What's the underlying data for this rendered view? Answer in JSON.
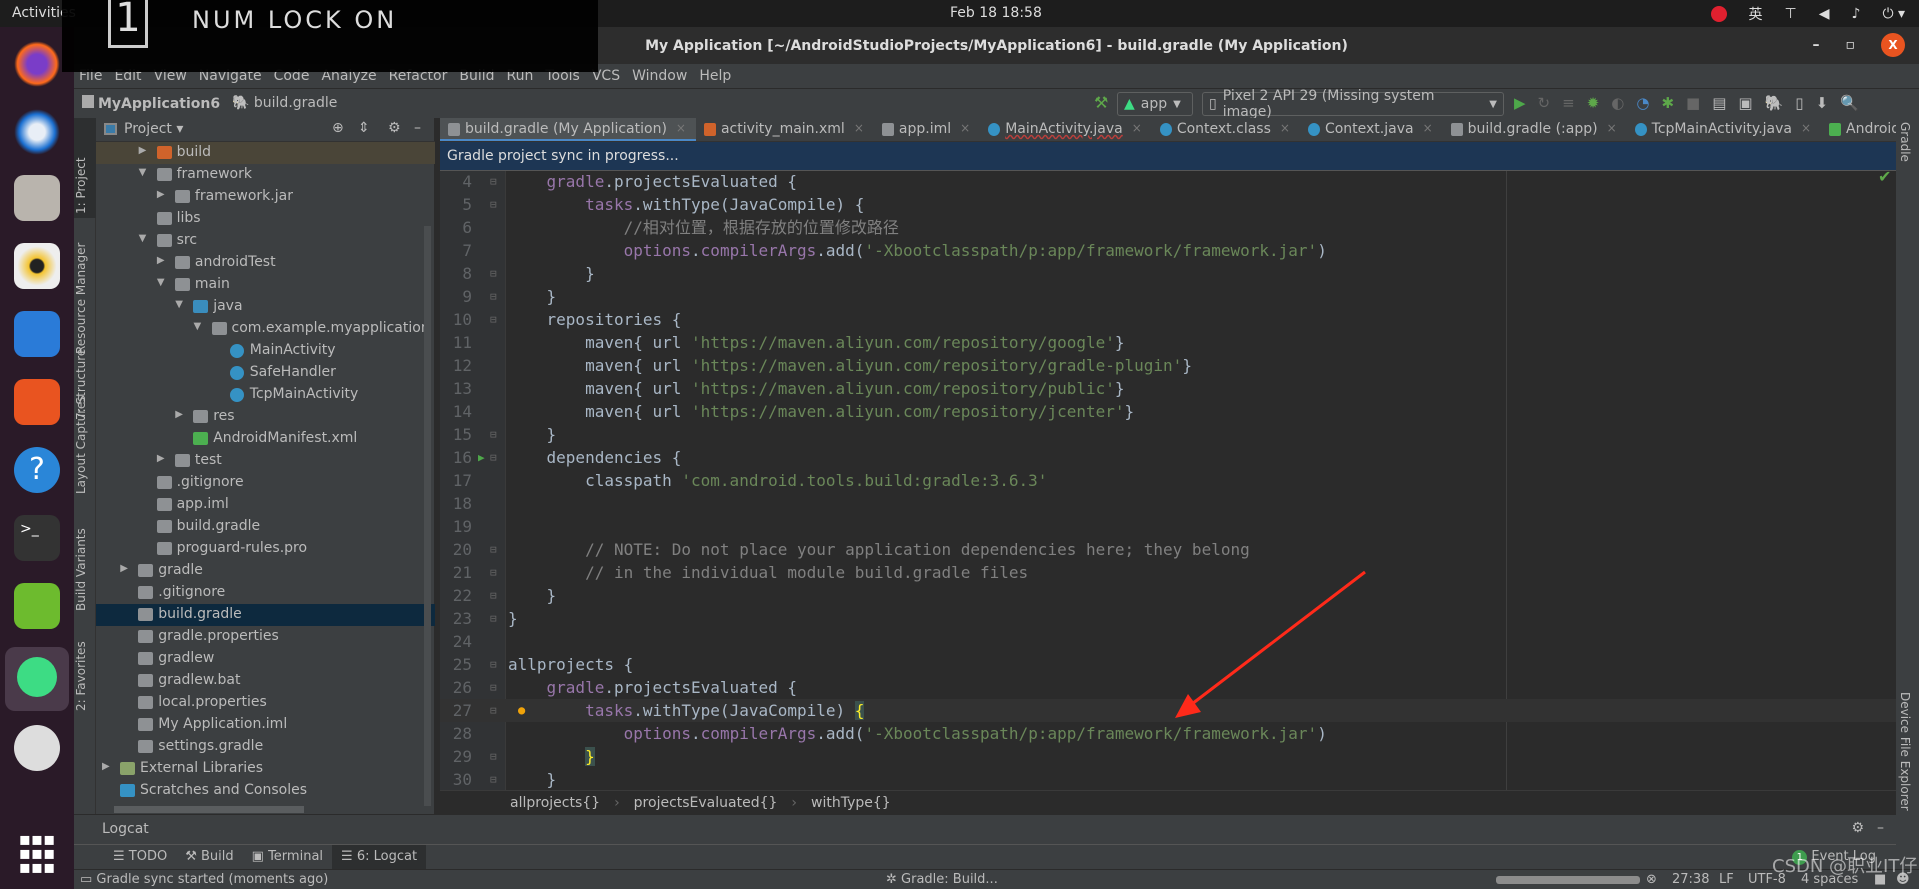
{
  "os": {
    "activities": "Activities",
    "clock": "Feb 18  18:58",
    "input_method": "英",
    "numlock_digit": "1",
    "numlock_text": "NUM LOCK ON"
  },
  "window": {
    "title": "My Application [~/AndroidStudioProjects/MyApplication6] - build.gradle (My Application)"
  },
  "menu": [
    "File",
    "Edit",
    "View",
    "Navigate",
    "Code",
    "Analyze",
    "Refactor",
    "Build",
    "Run",
    "Tools",
    "VCS",
    "Window",
    "Help"
  ],
  "nav": {
    "project": "MyApplication6",
    "file": "build.gradle",
    "run_config": "app",
    "device": "Pixel 2 API 29 (Missing system image)"
  },
  "left_strip": [
    "1: Project",
    "Resource Manager",
    "7: Structure",
    "Layout Captures",
    "Build Variants",
    "2: Favorites"
  ],
  "right_strip": [
    "Gradle",
    "Device File Explorer"
  ],
  "project_panel": {
    "title": "Project",
    "rows": [
      {
        "label": "build",
        "depth": 2,
        "arrow": "closed",
        "icon": "folder-excluded"
      },
      {
        "label": "framework",
        "depth": 2,
        "arrow": "open",
        "icon": "folder"
      },
      {
        "label": "framework.jar",
        "depth": 3,
        "arrow": "closed",
        "icon": "jar"
      },
      {
        "label": "libs",
        "depth": 2,
        "arrow": "none",
        "icon": "folder"
      },
      {
        "label": "src",
        "depth": 2,
        "arrow": "open",
        "icon": "folder"
      },
      {
        "label": "androidTest",
        "depth": 3,
        "arrow": "closed",
        "icon": "folder"
      },
      {
        "label": "main",
        "depth": 3,
        "arrow": "open",
        "icon": "folder"
      },
      {
        "label": "java",
        "depth": 4,
        "arrow": "open",
        "icon": "folder-source"
      },
      {
        "label": "com.example.myapplication",
        "depth": 5,
        "arrow": "open",
        "icon": "package"
      },
      {
        "label": "MainActivity",
        "depth": 6,
        "arrow": "none",
        "icon": "class"
      },
      {
        "label": "SafeHandler",
        "depth": 6,
        "arrow": "none",
        "icon": "class"
      },
      {
        "label": "TcpMainActivity",
        "depth": 6,
        "arrow": "none",
        "icon": "class"
      },
      {
        "label": "res",
        "depth": 4,
        "arrow": "closed",
        "icon": "folder-res"
      },
      {
        "label": "AndroidManifest.xml",
        "depth": 4,
        "arrow": "none",
        "icon": "manifest"
      },
      {
        "label": "test",
        "depth": 3,
        "arrow": "closed",
        "icon": "folder"
      },
      {
        "label": ".gitignore",
        "depth": 2,
        "arrow": "none",
        "icon": "ignore-file"
      },
      {
        "label": "app.iml",
        "depth": 2,
        "arrow": "none",
        "icon": "module-file"
      },
      {
        "label": "build.gradle",
        "depth": 2,
        "arrow": "none",
        "icon": "gradle"
      },
      {
        "label": "proguard-rules.pro",
        "depth": 2,
        "arrow": "none",
        "icon": "text-file"
      },
      {
        "label": "gradle",
        "depth": 1,
        "arrow": "closed",
        "icon": "folder"
      },
      {
        "label": ".gitignore",
        "depth": 1,
        "arrow": "none",
        "icon": "ignore-file"
      },
      {
        "label": "build.gradle",
        "depth": 1,
        "arrow": "none",
        "icon": "gradle",
        "selected": true
      },
      {
        "label": "gradle.properties",
        "depth": 1,
        "arrow": "none",
        "icon": "properties"
      },
      {
        "label": "gradlew",
        "depth": 1,
        "arrow": "none",
        "icon": "shell"
      },
      {
        "label": "gradlew.bat",
        "depth": 1,
        "arrow": "none",
        "icon": "text-file"
      },
      {
        "label": "local.properties",
        "depth": 1,
        "arrow": "none",
        "icon": "properties"
      },
      {
        "label": "My Application.iml",
        "depth": 1,
        "arrow": "none",
        "icon": "module-file"
      },
      {
        "label": "settings.gradle",
        "depth": 1,
        "arrow": "none",
        "icon": "gradle"
      },
      {
        "label": "External Libraries",
        "depth": 0,
        "arrow": "closed",
        "icon": "libraries"
      },
      {
        "label": "Scratches and Consoles",
        "depth": 0,
        "arrow": "none",
        "icon": "scratches"
      }
    ]
  },
  "tabs": [
    {
      "label": "build.gradle (My Application)",
      "icon": "gradle",
      "active": true
    },
    {
      "label": "activity_main.xml",
      "icon": "xml"
    },
    {
      "label": "app.iml",
      "icon": "module-file"
    },
    {
      "label": "MainActivity.java",
      "icon": "class"
    },
    {
      "label": "Context.class",
      "icon": "class"
    },
    {
      "label": "Context.java",
      "icon": "class"
    },
    {
      "label": "build.gradle (:app)",
      "icon": "gradle"
    },
    {
      "label": "TcpMainActivity.java",
      "icon": "class"
    },
    {
      "label": "AndroidI",
      "icon": "manifest"
    }
  ],
  "banner": "Gradle project sync in progress...",
  "code": {
    "current_line": 27,
    "lines": [
      {
        "n": 4,
        "t": [
          [
            "    ",
            "p"
          ],
          [
            "gradle",
            "k"
          ],
          [
            ".projectsEvaluated {",
            "p"
          ]
        ]
      },
      {
        "n": 5,
        "t": [
          [
            "        ",
            "p"
          ],
          [
            "tasks",
            "k"
          ],
          [
            ".withType(JavaCompile) {",
            "p"
          ]
        ]
      },
      {
        "n": 6,
        "t": [
          [
            "            ",
            "p"
          ],
          [
            "//相对位置，根据存放的位置修改路径",
            "c"
          ]
        ]
      },
      {
        "n": 7,
        "t": [
          [
            "            ",
            "p"
          ],
          [
            "options",
            "k"
          ],
          [
            ".",
            "p"
          ],
          [
            "compilerArgs",
            "k"
          ],
          [
            ".add(",
            "p"
          ],
          [
            "'-Xbootclasspath/p:app/framework/framework.jar'",
            "s"
          ],
          [
            ")",
            "p"
          ]
        ]
      },
      {
        "n": 8,
        "t": [
          [
            "        }",
            "p"
          ]
        ]
      },
      {
        "n": 9,
        "t": [
          [
            "    }",
            "p"
          ]
        ]
      },
      {
        "n": 10,
        "t": [
          [
            "    repositories {",
            "p"
          ]
        ]
      },
      {
        "n": 11,
        "t": [
          [
            "        maven{ url ",
            "p"
          ],
          [
            "'https://maven.aliyun.com/repository/google'",
            "s"
          ],
          [
            "}",
            "p"
          ]
        ]
      },
      {
        "n": 12,
        "t": [
          [
            "        maven{ url ",
            "p"
          ],
          [
            "'https://maven.aliyun.com/repository/gradle-plugin'",
            "s"
          ],
          [
            "}",
            "p"
          ]
        ]
      },
      {
        "n": 13,
        "t": [
          [
            "        maven{ url ",
            "p"
          ],
          [
            "'https://maven.aliyun.com/repository/public'",
            "s"
          ],
          [
            "}",
            "p"
          ]
        ]
      },
      {
        "n": 14,
        "t": [
          [
            "        maven{ url ",
            "p"
          ],
          [
            "'https://maven.aliyun.com/repository/jcenter'",
            "s"
          ],
          [
            "}",
            "p"
          ]
        ]
      },
      {
        "n": 15,
        "t": [
          [
            "    }",
            "p"
          ]
        ]
      },
      {
        "n": 16,
        "t": [
          [
            "    dependencies {",
            "p"
          ]
        ]
      },
      {
        "n": 17,
        "t": [
          [
            "        classpath ",
            "p"
          ],
          [
            "'com.android.tools.build:gradle:3.6.3'",
            "s"
          ]
        ]
      },
      {
        "n": 18,
        "t": []
      },
      {
        "n": 19,
        "t": []
      },
      {
        "n": 20,
        "t": [
          [
            "        ",
            "p"
          ],
          [
            "// NOTE: Do not place your application dependencies here; they belong",
            "c"
          ]
        ]
      },
      {
        "n": 21,
        "t": [
          [
            "        ",
            "p"
          ],
          [
            "// in the individual module build.gradle files",
            "c"
          ]
        ]
      },
      {
        "n": 22,
        "t": [
          [
            "    }",
            "p"
          ]
        ]
      },
      {
        "n": 23,
        "t": [
          [
            "}",
            "p"
          ]
        ]
      },
      {
        "n": 24,
        "t": []
      },
      {
        "n": 25,
        "t": [
          [
            "allprojects {",
            "p"
          ]
        ]
      },
      {
        "n": 26,
        "t": [
          [
            "    ",
            "p"
          ],
          [
            "gradle",
            "k"
          ],
          [
            ".projectsEvaluated {",
            "p"
          ]
        ]
      },
      {
        "n": 27,
        "t": [
          [
            "        ",
            "p"
          ],
          [
            "tasks",
            "k"
          ],
          [
            ".withType(JavaCompile) ",
            "p"
          ],
          [
            "{",
            "b"
          ]
        ]
      },
      {
        "n": 28,
        "t": [
          [
            "            ",
            "p"
          ],
          [
            "options",
            "k"
          ],
          [
            ".",
            "p"
          ],
          [
            "compilerArgs",
            "k"
          ],
          [
            ".add(",
            "p"
          ],
          [
            "'-Xbootclasspath/p:app/framework/framework.jar'",
            "s"
          ],
          [
            ")",
            "p"
          ]
        ]
      },
      {
        "n": 29,
        "t": [
          [
            "        ",
            "p"
          ],
          [
            "}",
            "b"
          ]
        ]
      },
      {
        "n": 30,
        "t": [
          [
            "    }",
            "p"
          ]
        ]
      }
    ]
  },
  "breadcrumb": [
    "allprojects{}",
    "projectsEvaluated{}",
    "withType{}"
  ],
  "logcat": {
    "title": "Logcat"
  },
  "bottom_tabs": [
    {
      "label": "TODO"
    },
    {
      "label": "Build"
    },
    {
      "label": "Terminal"
    },
    {
      "label": "6: Logcat",
      "active": true
    }
  ],
  "status": {
    "message": "Gradle sync started (moments ago)",
    "task": "Gradle: Build...",
    "position": "27:38",
    "line_sep": "LF",
    "encoding": "UTF-8",
    "indent": "4 spaces",
    "event_log": "Event Log",
    "event_count": "1"
  },
  "watermark": "CSDN @职业IT仔",
  "colors": {
    "accent": "#4a88c7",
    "keyword": "#9876aa",
    "string": "#6a8759",
    "comment": "#808080",
    "arrow": "#ff2a1a"
  }
}
